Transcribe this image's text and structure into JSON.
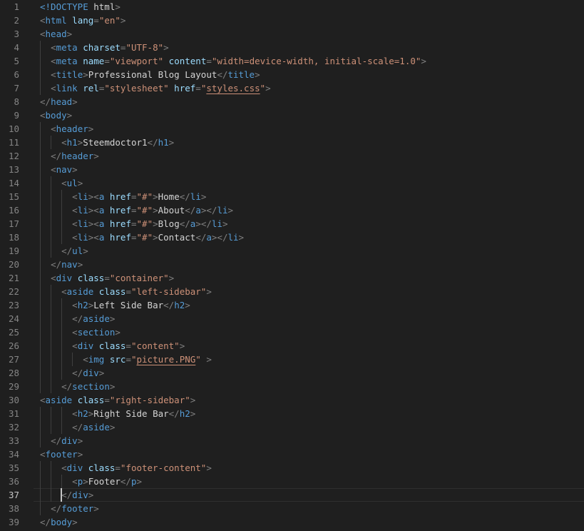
{
  "theme": {
    "background": "#1f1f1f",
    "punctuation": "#808080",
    "tag": "#569cd6",
    "attribute": "#9cdcfe",
    "string": "#ce9178",
    "text": "#d4d4d4",
    "line_number": "#858585",
    "active_line_number": "#c6c6c6",
    "indent_guide": "#3f3f3f",
    "current_line_border": "#2f2f2f",
    "cursor": "#c6c6c6"
  },
  "editor": {
    "language": "html",
    "active_line": 37,
    "cursor": {
      "line": 37,
      "col": 4
    },
    "lines": [
      {
        "n": 1,
        "indent": 0,
        "tokens": [
          [
            "t",
            "<!DOCTYPE"
          ],
          [
            "x",
            " html"
          ],
          [
            "p",
            ">"
          ]
        ]
      },
      {
        "n": 2,
        "indent": 0,
        "tokens": [
          [
            "p",
            "<"
          ],
          [
            "t",
            "html"
          ],
          [
            "a",
            " lang"
          ],
          [
            "p",
            "="
          ],
          [
            "s",
            "\"en\""
          ],
          [
            "p",
            ">"
          ]
        ]
      },
      {
        "n": 3,
        "indent": 0,
        "tokens": [
          [
            "p",
            "<"
          ],
          [
            "t",
            "head"
          ],
          [
            "p",
            ">"
          ]
        ]
      },
      {
        "n": 4,
        "indent": 2,
        "tokens": [
          [
            "p",
            "<"
          ],
          [
            "t",
            "meta"
          ],
          [
            "a",
            " charset"
          ],
          [
            "p",
            "="
          ],
          [
            "s",
            "\"UTF-8\""
          ],
          [
            "p",
            ">"
          ]
        ]
      },
      {
        "n": 5,
        "indent": 2,
        "tokens": [
          [
            "p",
            "<"
          ],
          [
            "t",
            "meta"
          ],
          [
            "a",
            " name"
          ],
          [
            "p",
            "="
          ],
          [
            "s",
            "\"viewport\""
          ],
          [
            "a",
            " content"
          ],
          [
            "p",
            "="
          ],
          [
            "s",
            "\"width=device-width, initial-scale=1.0\""
          ],
          [
            "p",
            ">"
          ]
        ]
      },
      {
        "n": 6,
        "indent": 2,
        "tokens": [
          [
            "p",
            "<"
          ],
          [
            "t",
            "title"
          ],
          [
            "p",
            ">"
          ],
          [
            "x",
            "Professional Blog Layout"
          ],
          [
            "p",
            "</"
          ],
          [
            "t",
            "title"
          ],
          [
            "p",
            ">"
          ]
        ]
      },
      {
        "n": 7,
        "indent": 2,
        "tokens": [
          [
            "p",
            "<"
          ],
          [
            "t",
            "link"
          ],
          [
            "a",
            " rel"
          ],
          [
            "p",
            "="
          ],
          [
            "s",
            "\"stylesheet\""
          ],
          [
            "a",
            " href"
          ],
          [
            "p",
            "="
          ],
          [
            "s",
            "\""
          ],
          [
            "u",
            "styles.css"
          ],
          [
            "s",
            "\""
          ],
          [
            "p",
            ">"
          ]
        ]
      },
      {
        "n": 8,
        "indent": 0,
        "tokens": [
          [
            "p",
            "</"
          ],
          [
            "t",
            "head"
          ],
          [
            "p",
            ">"
          ]
        ]
      },
      {
        "n": 9,
        "indent": 0,
        "tokens": [
          [
            "p",
            "<"
          ],
          [
            "t",
            "body"
          ],
          [
            "p",
            ">"
          ]
        ]
      },
      {
        "n": 10,
        "indent": 2,
        "tokens": [
          [
            "p",
            "<"
          ],
          [
            "t",
            "header"
          ],
          [
            "p",
            ">"
          ]
        ]
      },
      {
        "n": 11,
        "indent": 4,
        "tokens": [
          [
            "p",
            "<"
          ],
          [
            "t",
            "h1"
          ],
          [
            "p",
            ">"
          ],
          [
            "x",
            "Steemdoctor1"
          ],
          [
            "p",
            "</"
          ],
          [
            "t",
            "h1"
          ],
          [
            "p",
            ">"
          ]
        ]
      },
      {
        "n": 12,
        "indent": 2,
        "tokens": [
          [
            "p",
            "</"
          ],
          [
            "t",
            "header"
          ],
          [
            "p",
            ">"
          ]
        ]
      },
      {
        "n": 13,
        "indent": 2,
        "tokens": [
          [
            "p",
            "<"
          ],
          [
            "t",
            "nav"
          ],
          [
            "p",
            ">"
          ]
        ]
      },
      {
        "n": 14,
        "indent": 4,
        "tokens": [
          [
            "p",
            "<"
          ],
          [
            "t",
            "ul"
          ],
          [
            "p",
            ">"
          ]
        ]
      },
      {
        "n": 15,
        "indent": 6,
        "tokens": [
          [
            "p",
            "<"
          ],
          [
            "t",
            "li"
          ],
          [
            "p",
            "><"
          ],
          [
            "t",
            "a"
          ],
          [
            "a",
            " href"
          ],
          [
            "p",
            "="
          ],
          [
            "s",
            "\"#\""
          ],
          [
            "p",
            ">"
          ],
          [
            "x",
            "Home"
          ],
          [
            "p",
            "</"
          ],
          [
            "t",
            "li"
          ],
          [
            "p",
            ">"
          ]
        ]
      },
      {
        "n": 16,
        "indent": 6,
        "tokens": [
          [
            "p",
            "<"
          ],
          [
            "t",
            "li"
          ],
          [
            "p",
            "><"
          ],
          [
            "t",
            "a"
          ],
          [
            "a",
            " href"
          ],
          [
            "p",
            "="
          ],
          [
            "s",
            "\"#\""
          ],
          [
            "p",
            ">"
          ],
          [
            "x",
            "About"
          ],
          [
            "p",
            "</"
          ],
          [
            "t",
            "a"
          ],
          [
            "p",
            "></"
          ],
          [
            "t",
            "li"
          ],
          [
            "p",
            ">"
          ]
        ]
      },
      {
        "n": 17,
        "indent": 6,
        "tokens": [
          [
            "p",
            "<"
          ],
          [
            "t",
            "li"
          ],
          [
            "p",
            "><"
          ],
          [
            "t",
            "a"
          ],
          [
            "a",
            " href"
          ],
          [
            "p",
            "="
          ],
          [
            "s",
            "\"#\""
          ],
          [
            "p",
            ">"
          ],
          [
            "x",
            "Blog"
          ],
          [
            "p",
            "</"
          ],
          [
            "t",
            "a"
          ],
          [
            "p",
            "></"
          ],
          [
            "t",
            "li"
          ],
          [
            "p",
            ">"
          ]
        ]
      },
      {
        "n": 18,
        "indent": 6,
        "tokens": [
          [
            "p",
            "<"
          ],
          [
            "t",
            "li"
          ],
          [
            "p",
            "><"
          ],
          [
            "t",
            "a"
          ],
          [
            "a",
            " href"
          ],
          [
            "p",
            "="
          ],
          [
            "s",
            "\"#\""
          ],
          [
            "p",
            ">"
          ],
          [
            "x",
            "Contact"
          ],
          [
            "p",
            "</"
          ],
          [
            "t",
            "a"
          ],
          [
            "p",
            "></"
          ],
          [
            "t",
            "li"
          ],
          [
            "p",
            ">"
          ]
        ]
      },
      {
        "n": 19,
        "indent": 4,
        "tokens": [
          [
            "p",
            "</"
          ],
          [
            "t",
            "ul"
          ],
          [
            "p",
            ">"
          ]
        ]
      },
      {
        "n": 20,
        "indent": 2,
        "tokens": [
          [
            "p",
            "</"
          ],
          [
            "t",
            "nav"
          ],
          [
            "p",
            ">"
          ]
        ]
      },
      {
        "n": 21,
        "indent": 2,
        "tokens": [
          [
            "p",
            "<"
          ],
          [
            "t",
            "div"
          ],
          [
            "a",
            " class"
          ],
          [
            "p",
            "="
          ],
          [
            "s",
            "\"container\""
          ],
          [
            "p",
            ">"
          ]
        ]
      },
      {
        "n": 22,
        "indent": 4,
        "tokens": [
          [
            "p",
            "<"
          ],
          [
            "t",
            "aside"
          ],
          [
            "a",
            " class"
          ],
          [
            "p",
            "="
          ],
          [
            "s",
            "\"left-sidebar\""
          ],
          [
            "p",
            ">"
          ]
        ]
      },
      {
        "n": 23,
        "indent": 6,
        "tokens": [
          [
            "p",
            "<"
          ],
          [
            "t",
            "h2"
          ],
          [
            "p",
            ">"
          ],
          [
            "x",
            "Left Side Bar"
          ],
          [
            "p",
            "</"
          ],
          [
            "t",
            "h2"
          ],
          [
            "p",
            ">"
          ]
        ]
      },
      {
        "n": 24,
        "indent": 6,
        "tokens": [
          [
            "p",
            "</"
          ],
          [
            "t",
            "aside"
          ],
          [
            "p",
            ">"
          ]
        ]
      },
      {
        "n": 25,
        "indent": 6,
        "tokens": [
          [
            "p",
            "<"
          ],
          [
            "t",
            "section"
          ],
          [
            "p",
            ">"
          ]
        ]
      },
      {
        "n": 26,
        "indent": 6,
        "tokens": [
          [
            "p",
            "<"
          ],
          [
            "t",
            "div"
          ],
          [
            "a",
            " class"
          ],
          [
            "p",
            "="
          ],
          [
            "s",
            "\"content\""
          ],
          [
            "p",
            ">"
          ]
        ]
      },
      {
        "n": 27,
        "indent": 8,
        "tokens": [
          [
            "p",
            "<"
          ],
          [
            "t",
            "img"
          ],
          [
            "a",
            " src"
          ],
          [
            "p",
            "="
          ],
          [
            "s",
            "\""
          ],
          [
            "u",
            "picture.PNG"
          ],
          [
            "s",
            "\""
          ],
          [
            "x",
            " "
          ],
          [
            "p",
            ">"
          ]
        ]
      },
      {
        "n": 28,
        "indent": 6,
        "tokens": [
          [
            "p",
            "</"
          ],
          [
            "t",
            "div"
          ],
          [
            "p",
            ">"
          ]
        ]
      },
      {
        "n": 29,
        "indent": 4,
        "tokens": [
          [
            "p",
            "</"
          ],
          [
            "t",
            "section"
          ],
          [
            "p",
            ">"
          ]
        ]
      },
      {
        "n": 30,
        "indent": 0,
        "tokens": [
          [
            "p",
            "<"
          ],
          [
            "t",
            "aside"
          ],
          [
            "a",
            " class"
          ],
          [
            "p",
            "="
          ],
          [
            "s",
            "\"right-sidebar\""
          ],
          [
            "p",
            ">"
          ]
        ]
      },
      {
        "n": 31,
        "indent": 6,
        "tokens": [
          [
            "p",
            "<"
          ],
          [
            "t",
            "h2"
          ],
          [
            "p",
            ">"
          ],
          [
            "x",
            "Right Side Bar"
          ],
          [
            "p",
            "</"
          ],
          [
            "t",
            "h2"
          ],
          [
            "p",
            ">"
          ]
        ]
      },
      {
        "n": 32,
        "indent": 6,
        "tokens": [
          [
            "p",
            "</"
          ],
          [
            "t",
            "aside"
          ],
          [
            "p",
            ">"
          ]
        ]
      },
      {
        "n": 33,
        "indent": 2,
        "tokens": [
          [
            "p",
            "</"
          ],
          [
            "t",
            "div"
          ],
          [
            "p",
            ">"
          ]
        ]
      },
      {
        "n": 34,
        "indent": 0,
        "tokens": [
          [
            "p",
            "<"
          ],
          [
            "t",
            "footer"
          ],
          [
            "p",
            ">"
          ]
        ]
      },
      {
        "n": 35,
        "indent": 4,
        "tokens": [
          [
            "p",
            "<"
          ],
          [
            "t",
            "div"
          ],
          [
            "a",
            " class"
          ],
          [
            "p",
            "="
          ],
          [
            "s",
            "\"footer-content\""
          ],
          [
            "p",
            ">"
          ]
        ]
      },
      {
        "n": 36,
        "indent": 6,
        "tokens": [
          [
            "p",
            "<"
          ],
          [
            "t",
            "p"
          ],
          [
            "p",
            ">"
          ],
          [
            "x",
            "Footer"
          ],
          [
            "p",
            "</"
          ],
          [
            "t",
            "p"
          ],
          [
            "p",
            ">"
          ]
        ]
      },
      {
        "n": 37,
        "indent": 4,
        "tokens": [
          [
            "p",
            "</"
          ],
          [
            "t",
            "div"
          ],
          [
            "p",
            ">"
          ]
        ]
      },
      {
        "n": 38,
        "indent": 2,
        "tokens": [
          [
            "p",
            "</"
          ],
          [
            "t",
            "footer"
          ],
          [
            "p",
            ">"
          ]
        ]
      },
      {
        "n": 39,
        "indent": 0,
        "tokens": [
          [
            "p",
            "</"
          ],
          [
            "t",
            "body"
          ],
          [
            "p",
            ">"
          ]
        ]
      }
    ]
  }
}
